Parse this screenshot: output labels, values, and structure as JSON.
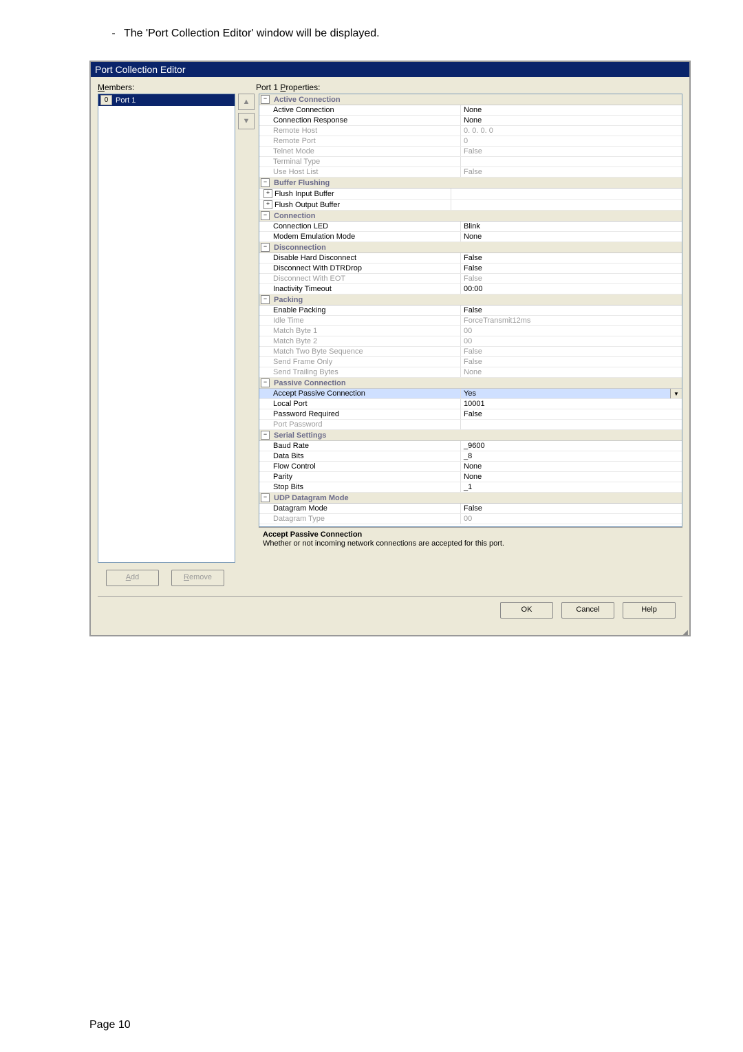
{
  "intro": "The 'Port Collection Editor' window will be displayed.",
  "page_number": "Page 10",
  "dialog": {
    "title": "Port Collection Editor",
    "members_label_rest": "embers:",
    "properties_label_prefix": "Port 1 ",
    "properties_label_rest": "roperties:",
    "add_rest": "dd",
    "remove_rest": "emove",
    "ok": "OK",
    "cancel": "Cancel",
    "help": "Help"
  },
  "members": [
    {
      "index": "0",
      "label": "Port 1"
    }
  ],
  "selected": {
    "title": "Accept Passive Connection",
    "desc": "Whether or not incoming network connections are accepted for this port."
  },
  "categories": [
    {
      "name": "Active Connection",
      "props": [
        {
          "name": "Active Connection",
          "value": "None",
          "disabled": false
        },
        {
          "name": "Connection Response",
          "value": "None",
          "disabled": false
        },
        {
          "name": "Remote Host",
          "value": "0. 0. 0. 0",
          "disabled": true
        },
        {
          "name": "Remote Port",
          "value": "0",
          "disabled": true
        },
        {
          "name": "Telnet Mode",
          "value": "False",
          "disabled": true
        },
        {
          "name": "Terminal Type",
          "value": "",
          "disabled": true
        },
        {
          "name": "Use Host List",
          "value": "False",
          "disabled": true
        }
      ]
    },
    {
      "name": "Buffer Flushing",
      "props": [
        {
          "name": "Flush Input Buffer",
          "value": "",
          "disabled": false,
          "haschild": true
        },
        {
          "name": "Flush Output Buffer",
          "value": "",
          "disabled": false,
          "haschild": true
        }
      ]
    },
    {
      "name": "Connection",
      "props": [
        {
          "name": "Connection LED",
          "value": "Blink",
          "disabled": false
        },
        {
          "name": "Modem Emulation Mode",
          "value": "None",
          "disabled": false
        }
      ]
    },
    {
      "name": "Disconnection",
      "props": [
        {
          "name": "Disable Hard Disconnect",
          "value": "False",
          "disabled": false
        },
        {
          "name": "Disconnect With DTRDrop",
          "value": "False",
          "disabled": false
        },
        {
          "name": "Disconnect With EOT",
          "value": "False",
          "disabled": true
        },
        {
          "name": "Inactivity Timeout",
          "value": "00:00",
          "disabled": false
        }
      ]
    },
    {
      "name": "Packing",
      "props": [
        {
          "name": "Enable Packing",
          "value": "False",
          "disabled": false
        },
        {
          "name": "Idle Time",
          "value": "ForceTransmit12ms",
          "disabled": true
        },
        {
          "name": "Match Byte 1",
          "value": "00",
          "disabled": true
        },
        {
          "name": "Match Byte 2",
          "value": "00",
          "disabled": true
        },
        {
          "name": "Match Two Byte Sequence",
          "value": "False",
          "disabled": true
        },
        {
          "name": "Send Frame Only",
          "value": "False",
          "disabled": true
        },
        {
          "name": "Send Trailing Bytes",
          "value": "None",
          "disabled": true
        }
      ]
    },
    {
      "name": "Passive Connection",
      "props": [
        {
          "name": "Accept Passive Connection",
          "value": "Yes",
          "disabled": false,
          "selected": true,
          "dropdown": true
        },
        {
          "name": "Local Port",
          "value": "10001",
          "disabled": false
        },
        {
          "name": "Password Required",
          "value": "False",
          "disabled": false
        },
        {
          "name": "Port Password",
          "value": "",
          "disabled": true
        }
      ]
    },
    {
      "name": "Serial Settings",
      "props": [
        {
          "name": "Baud Rate",
          "value": "_9600",
          "disabled": false
        },
        {
          "name": "Data Bits",
          "value": "_8",
          "disabled": false
        },
        {
          "name": "Flow Control",
          "value": "None",
          "disabled": false
        },
        {
          "name": "Parity",
          "value": "None",
          "disabled": false
        },
        {
          "name": "Stop Bits",
          "value": "_1",
          "disabled": false
        }
      ]
    },
    {
      "name": "UDP Datagram Mode",
      "props": [
        {
          "name": "Datagram Mode",
          "value": "False",
          "disabled": false
        },
        {
          "name": "Datagram Type",
          "value": "00",
          "disabled": true
        }
      ]
    }
  ]
}
